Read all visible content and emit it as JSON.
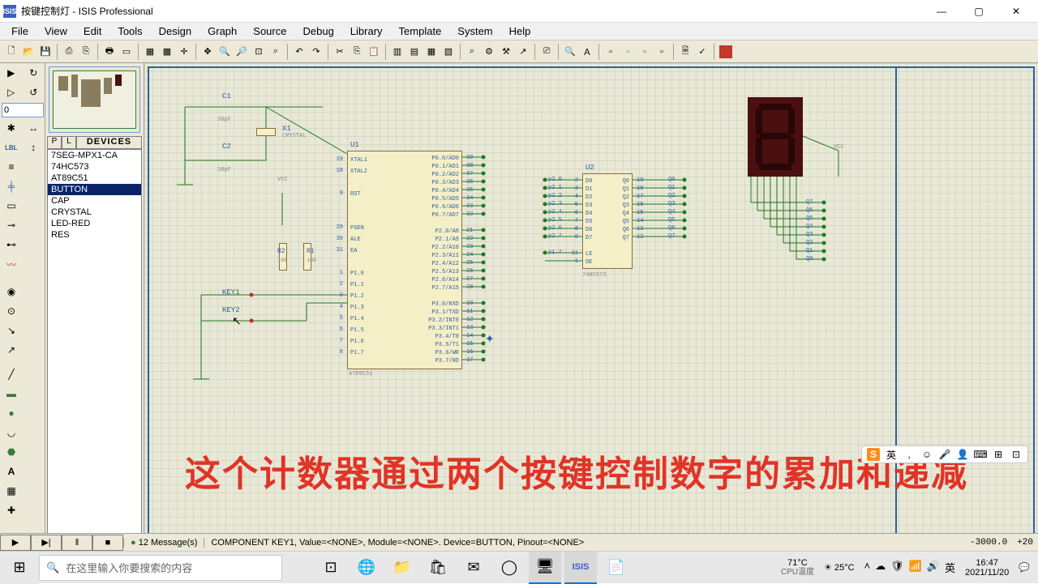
{
  "window": {
    "title": "按键控制灯 - ISIS Professional",
    "minimize": "—",
    "maximize": "▢",
    "close": "✕"
  },
  "menu": [
    "File",
    "View",
    "Edit",
    "Tools",
    "Design",
    "Graph",
    "Source",
    "Debug",
    "Library",
    "Template",
    "System",
    "Help"
  ],
  "devices": {
    "tab_p": "P",
    "tab_l": "L",
    "header": "DEVICES",
    "items": [
      "7SEG-MPX1-CA",
      "74HC573",
      "AT89C51",
      "BUTTON",
      "CAP",
      "CRYSTAL",
      "LED-RED",
      "RES"
    ],
    "selected_index": 3
  },
  "overview_input": "0",
  "schematic": {
    "components": {
      "C1": "C1",
      "C2": "C2",
      "X1": "X1",
      "X1_sub": "CRYSTAL",
      "U1": "U1",
      "U1_sub": "AT89C51",
      "U2": "U2",
      "U2_sub": "74HC573",
      "R1": "R1",
      "R1_val": "10k",
      "R2": "R2",
      "R2_val": "10k",
      "KEY1": "KEY1",
      "KEY2": "KEY2",
      "cap_val": "30pF",
      "VCC": "VCC",
      "VCC_label": "VCC"
    },
    "u1_left": [
      "XTAL1",
      "XTAL2",
      "",
      "RST",
      "",
      "",
      "PSEN",
      "ALE",
      "EA",
      "",
      "P1.0",
      "P1.1",
      "P1.2",
      "P1.3",
      "P1.4",
      "P1.5",
      "P1.6",
      "P1.7"
    ],
    "u1_left_nums": [
      "19",
      "18",
      "",
      "9",
      "",
      "",
      "29",
      "30",
      "31",
      "",
      "1",
      "2",
      "3",
      "4",
      "5",
      "6",
      "7",
      "8"
    ],
    "u1_right": [
      "P0.0/AD0",
      "P0.1/AD1",
      "P0.2/AD2",
      "P0.3/AD3",
      "P0.4/AD4",
      "P0.5/AD5",
      "P0.6/AD6",
      "P0.7/AD7",
      "",
      "P2.0/A8",
      "P2.1/A9",
      "P2.2/A10",
      "P2.3/A11",
      "P2.4/A12",
      "P2.5/A13",
      "P2.6/A14",
      "P2.7/A15",
      "",
      "P3.0/RXD",
      "P3.1/TXD",
      "P3.2/INT0",
      "P3.3/INT1",
      "P3.4/T0",
      "P3.5/T1",
      "P3.6/WR",
      "P3.7/RD"
    ],
    "u1_right_nums": [
      "39",
      "38",
      "37",
      "36",
      "35",
      "34",
      "33",
      "32",
      "",
      "21",
      "22",
      "23",
      "24",
      "25",
      "26",
      "27",
      "28",
      "",
      "10",
      "11",
      "12",
      "13",
      "14",
      "15",
      "16",
      "17"
    ],
    "u2_left": [
      "D0",
      "D1",
      "D2",
      "D3",
      "D4",
      "D5",
      "D6",
      "D7",
      "",
      "LE",
      "OE"
    ],
    "u2_left_nums": [
      "2",
      "3",
      "4",
      "5",
      "6",
      "7",
      "8",
      "9",
      "",
      "11",
      "1"
    ],
    "u2_left_nets": [
      "p2.0",
      "p2.1",
      "p2.2",
      "p2.3",
      "p2.4",
      "p2.5",
      "p2.6",
      "p2.7",
      "",
      "p1.7",
      ""
    ],
    "u2_right": [
      "Q0",
      "Q1",
      "Q2",
      "Q3",
      "Q4",
      "Q5",
      "Q6",
      "Q7"
    ],
    "u2_right_nums": [
      "19",
      "18",
      "17",
      "16",
      "15",
      "14",
      "13",
      "12"
    ],
    "u2_right_nets": [
      "Q0",
      "Q1",
      "Q2",
      "Q3",
      "Q4",
      "Q5",
      "Q6",
      "Q7"
    ],
    "seg_nets": [
      "Q7",
      "Q6",
      "Q5",
      "Q4",
      "Q3",
      "Q2",
      "Q1",
      "Q0"
    ]
  },
  "overlay_text": "这个计数器通过两个按键控制数字的累加和递减",
  "ime": {
    "logo": "S",
    "lang": "英",
    "items": [
      "✏",
      "☺",
      "🎤",
      "👤",
      "⌨",
      "⊞",
      "⊡"
    ]
  },
  "status": {
    "messages": "12 Message(s)",
    "detail": "COMPONENT KEY1, Value=<NONE>, Module=<NONE>. Device=BUTTON, Pinout=<NONE>",
    "coord1": "-3000.0",
    "coord2": "+20"
  },
  "taskbar": {
    "search_placeholder": "在这里输入你要搜索的内容",
    "weather1": {
      "temp": "71°C",
      "label": "CPU温度"
    },
    "weather2": {
      "temp": "25°C",
      "icon": "☀"
    },
    "time": "16:47",
    "date": "2021/11/20"
  }
}
